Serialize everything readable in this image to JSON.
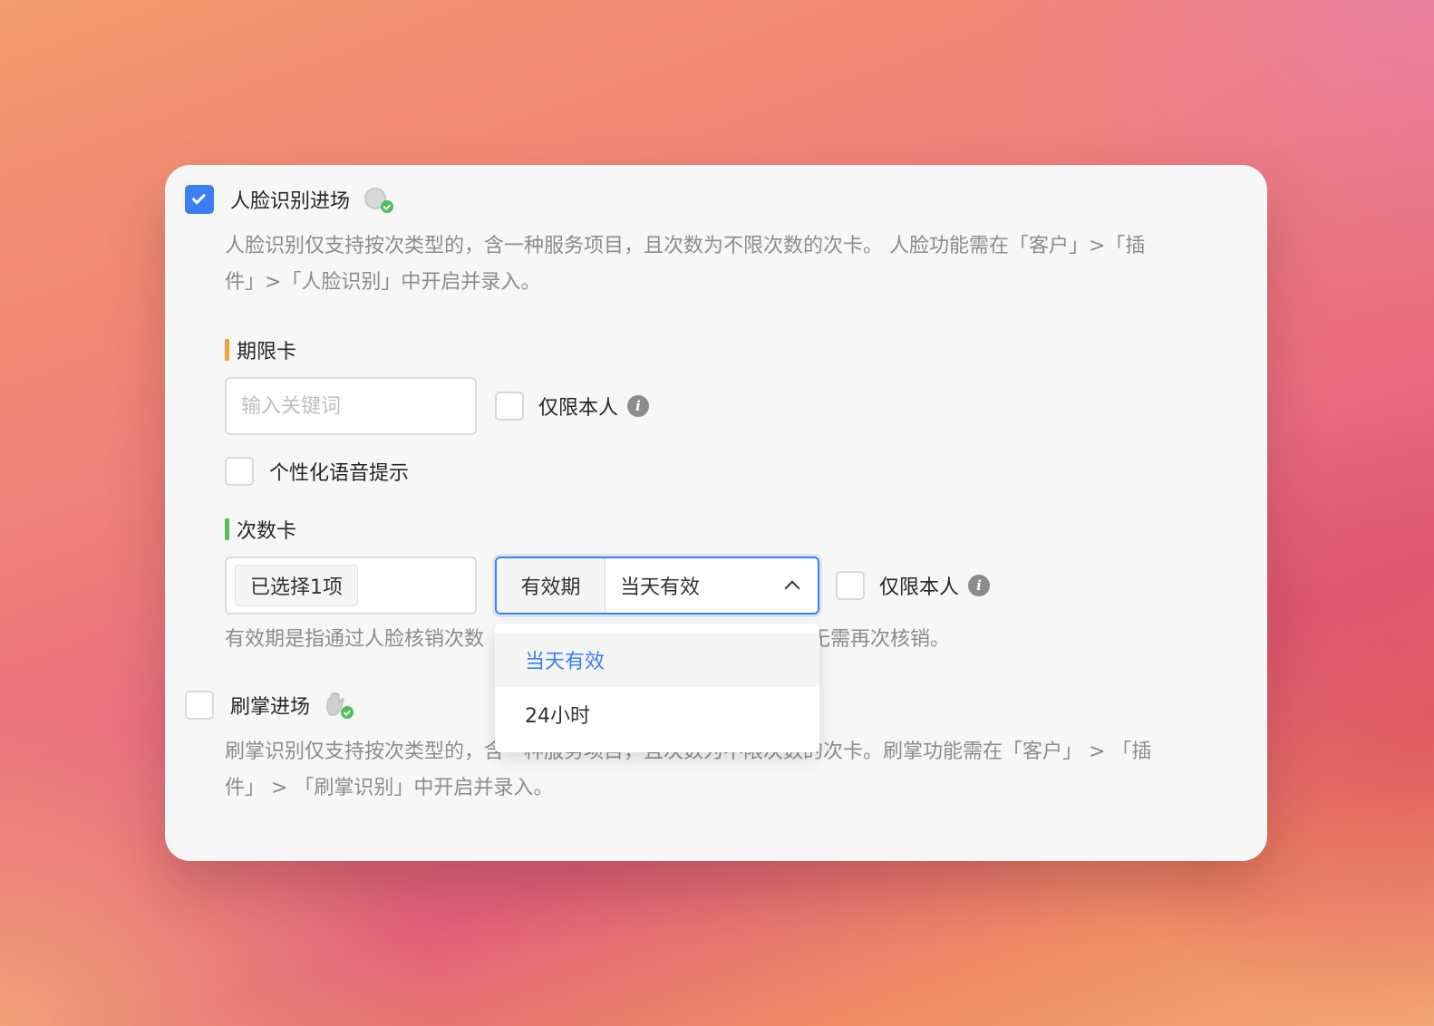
{
  "face": {
    "title": "人脸识别进场",
    "checked": true,
    "description_line1": "人脸识别仅支持按次类型的，含一种服务项目，且次数为不限次数的次卡。 人脸功能需在「客户」>「插",
    "description_line2": "件」>「人脸识别」中开启并录入。"
  },
  "period_card": {
    "title": "期限卡",
    "accent": "#f0a23c",
    "keyword_placeholder": "输入关键词",
    "owner_only_label": "仅限本人",
    "voice_prompt_label": "个性化语音提示"
  },
  "count_card": {
    "title": "次数卡",
    "accent": "#52c35c",
    "selected_tag": "已选择1项",
    "validity_prefix": "有效期",
    "validity_value": "当天有效",
    "owner_only_label": "仅限本人",
    "hint_left": "有效期是指通过人脸核销次数",
    "hint_right": "无需再次核销。"
  },
  "dropdown": {
    "options": [
      "当天有效",
      "24小时"
    ],
    "selected": "当天有效"
  },
  "palm": {
    "title": "刷掌进场",
    "checked": false,
    "description_line1": "刷掌识别仅支持按次类型的，含一种服务项目，且次数为不限次数的次卡。刷掌功能需在「客户」 > 「插",
    "description_line2": "件」 > 「刷掌识别」中开启并录入。"
  },
  "colors": {
    "primary": "#3b7ff3",
    "success": "#4cc05a"
  }
}
